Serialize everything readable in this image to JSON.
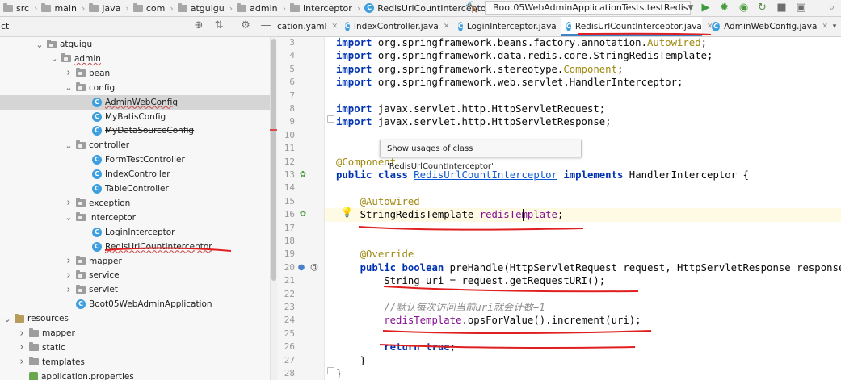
{
  "breadcrumb": [
    {
      "label": "src",
      "icon": "folder-icon"
    },
    {
      "label": "main",
      "icon": "folder-icon"
    },
    {
      "label": "java",
      "icon": "folder-icon"
    },
    {
      "label": "com",
      "icon": "folder-icon"
    },
    {
      "label": "atguigu",
      "icon": "folder-icon"
    },
    {
      "label": "admin",
      "icon": "folder-icon"
    },
    {
      "label": "interceptor",
      "icon": "folder-icon"
    },
    {
      "label": "RedisUrlCountInterceptor",
      "icon": "class-icon"
    }
  ],
  "toolbar": {
    "run_config": "Boot05WebAdminApplicationTests.testRedis",
    "icons": [
      "hammer-icon",
      "run-icon",
      "debug-icon",
      "coverage-icon",
      "profile-icon",
      "stop-icon",
      "window-icon"
    ]
  },
  "project_panel": {
    "title": "ct",
    "icons": [
      "target-icon",
      "collapse-icon",
      "gear-icon",
      "minimize-icon"
    ]
  },
  "tree": [
    {
      "label": "atguigu",
      "depth": 3,
      "kind": "package",
      "expanded": true
    },
    {
      "label": "admin",
      "depth": 4,
      "kind": "package",
      "expanded": true,
      "underline": true
    },
    {
      "label": "bean",
      "depth": 5,
      "kind": "package",
      "expanded": false
    },
    {
      "label": "config",
      "depth": 5,
      "kind": "package",
      "expanded": true
    },
    {
      "label": "AdminWebConfig",
      "depth": 6,
      "kind": "class",
      "selected": true,
      "underline": true
    },
    {
      "label": "MyBatisConfig",
      "depth": 6,
      "kind": "class"
    },
    {
      "label": "MyDataSourceConfig",
      "depth": 6,
      "kind": "class",
      "strike": true
    },
    {
      "label": "controller",
      "depth": 5,
      "kind": "package",
      "expanded": true
    },
    {
      "label": "FormTestController",
      "depth": 6,
      "kind": "class"
    },
    {
      "label": "IndexController",
      "depth": 6,
      "kind": "class"
    },
    {
      "label": "TableController",
      "depth": 6,
      "kind": "class"
    },
    {
      "label": "exception",
      "depth": 5,
      "kind": "package",
      "expanded": false
    },
    {
      "label": "interceptor",
      "depth": 5,
      "kind": "package",
      "expanded": true
    },
    {
      "label": "LoginInterceptor",
      "depth": 6,
      "kind": "class"
    },
    {
      "label": "RedisUrlCountInterceptor",
      "depth": 6,
      "kind": "class",
      "underline": true
    },
    {
      "label": "mapper",
      "depth": 5,
      "kind": "package",
      "expanded": false
    },
    {
      "label": "service",
      "depth": 5,
      "kind": "package",
      "expanded": false
    },
    {
      "label": "servlet",
      "depth": 5,
      "kind": "package",
      "expanded": false
    },
    {
      "label": "Boot05WebAdminApplication",
      "depth": 5,
      "kind": "class"
    },
    {
      "label": "resources",
      "depth": 1,
      "kind": "resources",
      "expanded": true
    },
    {
      "label": "mapper",
      "depth": 2,
      "kind": "folder",
      "expanded": false
    },
    {
      "label": "static",
      "depth": 2,
      "kind": "folder",
      "expanded": false
    },
    {
      "label": "templates",
      "depth": 2,
      "kind": "folder",
      "expanded": false
    },
    {
      "label": "application.properties",
      "depth": 2,
      "kind": "properties"
    }
  ],
  "tabs": [
    {
      "label": "cation.yaml",
      "active": false
    },
    {
      "label": "IndexController.java",
      "active": false
    },
    {
      "label": "LoginInterceptor.java",
      "active": false
    },
    {
      "label": "RedisUrlCountInterceptor.java",
      "active": true
    },
    {
      "label": "AdminWebConfig.java",
      "active": false
    }
  ],
  "tooltip": "Show usages of class 'RedisUrlCountInterceptor'",
  "code": [
    {
      "n": "3",
      "text": "import org.springframework.beans.factory.annotation.Autowired;"
    },
    {
      "n": "4",
      "text": "import org.springframework.data.redis.core.StringRedisTemplate;"
    },
    {
      "n": "5",
      "text": "import org.springframework.stereotype.Component;"
    },
    {
      "n": "6",
      "text": "import org.springframework.web.servlet.HandlerInterceptor;"
    },
    {
      "n": "7",
      "text": ""
    },
    {
      "n": "8",
      "text": "import javax.servlet.http.HttpServletRequest;"
    },
    {
      "n": "9",
      "text": "import javax.servlet.http.HttpServletResponse;"
    },
    {
      "n": "10",
      "text": ""
    },
    {
      "n": "11",
      "text": ""
    },
    {
      "n": "12",
      "text": "@Component"
    },
    {
      "n": "13",
      "text": "public class RedisUrlCountInterceptor implements HandlerInterceptor {"
    },
    {
      "n": "14",
      "text": ""
    },
    {
      "n": "15",
      "text": "    @Autowired"
    },
    {
      "n": "16",
      "text": "    StringRedisTemplate redisTemplate;"
    },
    {
      "n": "17",
      "text": ""
    },
    {
      "n": "18",
      "text": ""
    },
    {
      "n": "19",
      "text": "    @Override"
    },
    {
      "n": "20",
      "text": "    public boolean preHandle(HttpServletRequest request, HttpServletResponse response"
    },
    {
      "n": "21",
      "text": "        String uri = request.getRequestURI();"
    },
    {
      "n": "22",
      "text": ""
    },
    {
      "n": "23",
      "text": "        //默认每次访问当前uri就会计数+1"
    },
    {
      "n": "24",
      "text": "        redisTemplate.opsForValue().increment(uri);"
    },
    {
      "n": "25",
      "text": ""
    },
    {
      "n": "26",
      "text": "        return true;"
    },
    {
      "n": "27",
      "text": "    }"
    },
    {
      "n": "28",
      "text": "}"
    }
  ],
  "colors": {
    "keyword": "#0033b3",
    "annotation": "#9e880d",
    "field": "#871094",
    "comment": "#8c8c8c",
    "ink_marks": "#e02020",
    "active_tab": "#4083c9"
  }
}
